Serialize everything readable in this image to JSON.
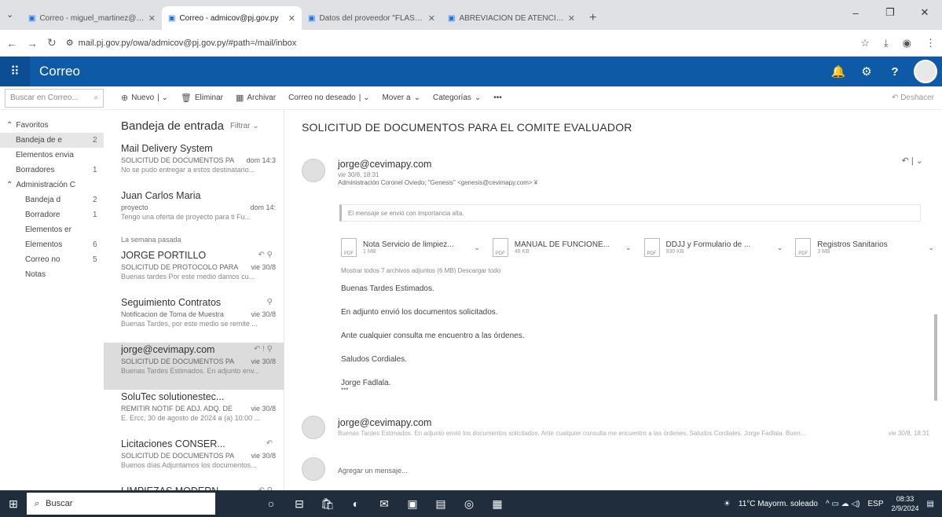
{
  "browser": {
    "tabs": [
      {
        "title": "Correo - miguel_martinez@pj...",
        "active": false
      },
      {
        "title": "Correo - admicov@pj.gov.py",
        "active": true
      },
      {
        "title": "Datos del proveedor \"FLASH ...",
        "active": false
      },
      {
        "title": "ABREVIACION DE ATENCION ...",
        "active": false
      }
    ],
    "url": "mail.pj.gov.py/owa/admicov@pj.gov.py/#path=/mail/inbox"
  },
  "app": {
    "name": "Correo"
  },
  "commands": {
    "search_placeholder": "Buscar en Correo...",
    "new": "Nuevo",
    "delete": "Eliminar",
    "archive": "Archivar",
    "junk": "Correo no deseado",
    "move": "Mover a",
    "categories": "Categorías",
    "more": "•••",
    "undo": "Deshacer"
  },
  "folders": [
    {
      "label": "Favoritos",
      "count": "",
      "indent": 0,
      "selected": false,
      "caret": "^"
    },
    {
      "label": "Bandeja de e",
      "count": "2",
      "indent": 1,
      "selected": true,
      "caret": ""
    },
    {
      "label": "Elementos envia",
      "count": "",
      "indent": 1,
      "selected": false,
      "caret": ""
    },
    {
      "label": "Borradores",
      "count": "1",
      "indent": 1,
      "selected": false,
      "caret": ""
    },
    {
      "label": "Administración C",
      "count": "",
      "indent": 0,
      "selected": false,
      "caret": "^"
    },
    {
      "label": "Bandeja d",
      "count": "2",
      "indent": 2,
      "selected": false,
      "caret": ""
    },
    {
      "label": "Borradore",
      "count": "1",
      "indent": 2,
      "selected": false,
      "caret": ""
    },
    {
      "label": "Elementos er",
      "count": "",
      "indent": 2,
      "selected": false,
      "caret": ""
    },
    {
      "label": "Elementos",
      "count": "6",
      "indent": 2,
      "selected": false,
      "caret": ""
    },
    {
      "label": "Correo no",
      "count": "5",
      "indent": 2,
      "selected": false,
      "caret": ""
    },
    {
      "label": "Notas",
      "count": "",
      "indent": 2,
      "selected": false,
      "caret": ""
    }
  ],
  "list": {
    "title": "Bandeja de entrada",
    "filter": "Filtrar",
    "group_label": "La semana pasada",
    "messages": [
      {
        "from": "Mail Delivery System",
        "subject": "SOLICITUD DE DOCUMENTOS PA",
        "date": "dom 14:3",
        "preview": "No se pudo entregar a estos destinatario...",
        "flags": "",
        "selected": false
      },
      {
        "from": "Juan Carlos Maria",
        "subject": "proyecto",
        "date": "dom 14:",
        "preview": "Tengo una oferta de proyecto para ti Fu...",
        "flags": "",
        "selected": false
      },
      {
        "from": "JORGE PORTILLO",
        "subject": "SOLICITUD DE PROTOCOLO PARA",
        "date": "vie 30/8",
        "preview": "Buenas tardes Por este medio damos cu...",
        "flags": "↶ ⚲",
        "selected": false
      },
      {
        "from": "Seguimiento Contratos",
        "subject": "Notificacion de Toma de Muestra",
        "date": "vie 30/8",
        "preview": "Buenas Tardes, por este medio se remite ...",
        "flags": "⚲",
        "selected": false
      },
      {
        "from": "jorge@cevimapy.com",
        "subject": "SOLICITUD DE DOCUMENTOS PA",
        "date": "vie 30/8",
        "preview": "Buenas Tardes Estimados. En adjunto env...",
        "flags": "↶ ! ⚲",
        "selected": true
      },
      {
        "from": "SoluTec solutionestec...",
        "subject": "REMITIR NOTIF DE ADJ. ADQ. DE",
        "date": "vie 30/8",
        "preview": "E. Ercc, 30 de agosto de 2024 a (a) 10:00 ...",
        "flags": "",
        "selected": false
      },
      {
        "from": "Licitaciones CONSER...",
        "subject": "SOLICITUD DE DOCUMENTOS PA",
        "date": "vie 30/8",
        "preview": "Buenos días Adjuntamos los documentos...",
        "flags": "↶",
        "selected": false
      },
      {
        "from": "LIMPIEZAS MODERN...",
        "subject": "Documentos Solicitados",
        "date": "vie 30/8",
        "preview": "",
        "flags": "↶ ⚲",
        "selected": false
      }
    ]
  },
  "reading": {
    "subject": "SOLICITUD DE DOCUMENTOS PARA EL COMITE EVALUADOR",
    "sender": "jorge@cevimapy.com",
    "date": "vie 30/8, 18:31",
    "to": "Administración Coronel Oviedo; \"Genesis\" <genesis@cevimapy.com> ¥",
    "importance": "El mensaje se envió con importancia alta.",
    "attachments": [
      {
        "name": "Nota Servicio de limpiez...",
        "size": "1 MB",
        "type": "PDF"
      },
      {
        "name": "MANUAL DE FUNCIONE...",
        "size": "46 KB",
        "type": "PDF"
      },
      {
        "name": "DDJJ y Formulario de ...",
        "size": "930 KB",
        "type": "PDF"
      },
      {
        "name": "Registros Sanitarios",
        "size": "3 MB",
        "type": "PDF"
      }
    ],
    "show_all": "Mostrar todos 7 archivos adjuntos (6 MB)   Descargar todo",
    "body": [
      "Buenas Tardes Estimados.",
      "En adjunto envió los documentos solicitados.",
      "Ante cualquier consulta me encuentro a las órdenes.",
      "Saludos Cordiales.",
      "Jorge Fadlala."
    ],
    "ellipsis": "•••",
    "second_sender": "jorge@cevimapy.com",
    "second_preview": "Buenas Tardes Estimados. En adjunto envió los documentos solicitados. Ante cualquier consulta me encuentro a las órdenes. Saludos Cordiales. Jorge Fadlala. Buen...",
    "second_date": "vie 30/8, 18:31",
    "reply_placeholder": "Agregar un mensaje..."
  },
  "taskbar": {
    "search_placeholder": "Buscar",
    "weather": "11°C  Mayorm. soleado",
    "lang": "ESP",
    "time": "08:33",
    "date": "2/9/2024"
  }
}
